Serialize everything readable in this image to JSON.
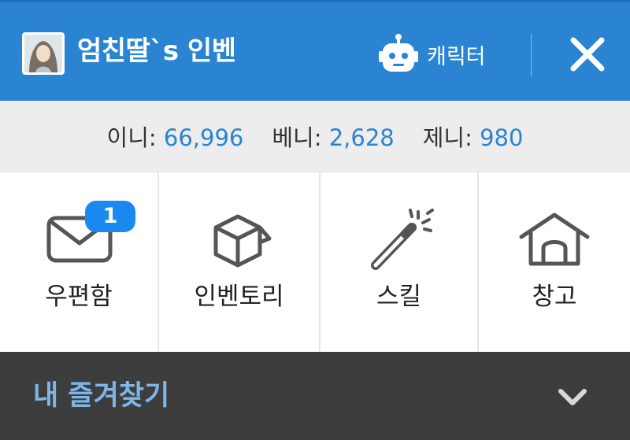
{
  "header": {
    "title": "엄친딸`s 인벤",
    "character_label": "캐릭터",
    "accent_color": "#2a84d2",
    "icons": [
      "avatar",
      "robot-icon",
      "close-icon"
    ]
  },
  "currencies": [
    {
      "label": "이니:",
      "value": "66,996"
    },
    {
      "label": "베니:",
      "value": "2,628"
    },
    {
      "label": "제니:",
      "value": "980"
    }
  ],
  "menu": [
    {
      "label": "우편함",
      "icon": "mail-icon",
      "badge": "1"
    },
    {
      "label": "인벤토리",
      "icon": "box-icon"
    },
    {
      "label": "스킬",
      "icon": "magic-wand-icon"
    },
    {
      "label": "창고",
      "icon": "house-icon"
    }
  ],
  "favorites": {
    "title": "내 즐겨찾기",
    "icon": "chevron-down-icon",
    "text_color": "#7fb6ea"
  }
}
